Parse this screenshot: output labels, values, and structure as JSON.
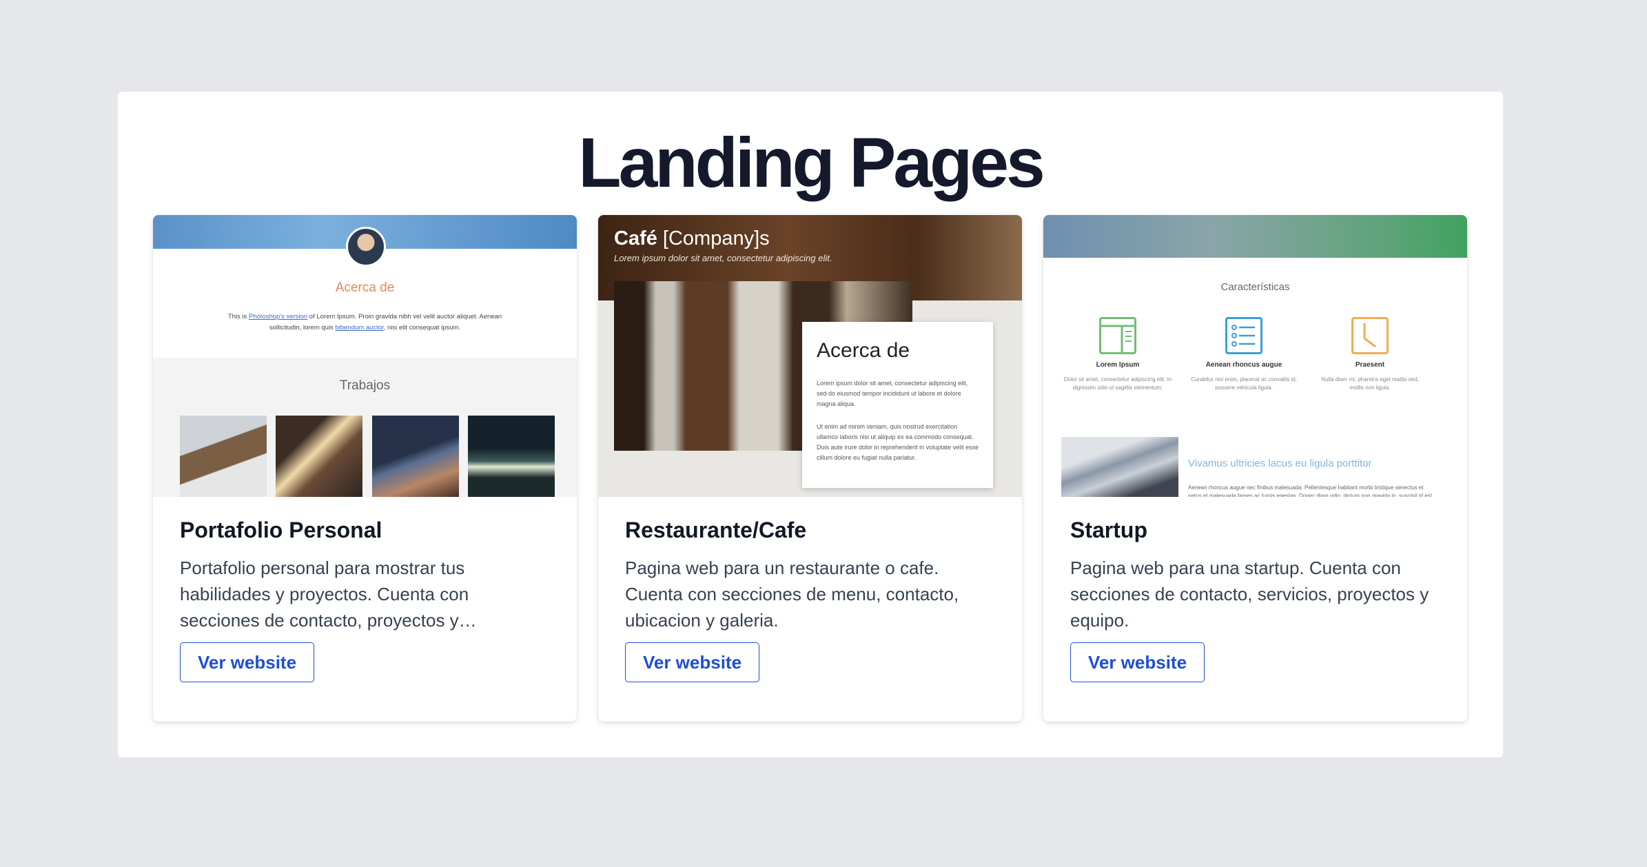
{
  "page": {
    "heading": "Landing Pages"
  },
  "cards": [
    {
      "title": "Portafolio Personal",
      "description": "Portafolio personal para mostrar tus habilidades y proyectos. Cuenta con secciones de contacto, proyectos y…",
      "button": "Ver website",
      "preview": {
        "about_title": "Acerca de",
        "about_text_1": "This is ",
        "about_link_1": "Photoshop's version",
        "about_text_2": " of Lorem Ipsum. Proin gravida nibh vel velit auctor aliquet. Aenean sollicitudin, lorem quis ",
        "about_link_2": "bibendum auctor",
        "about_text_3": ", nisi elit consequat ipsum.",
        "works_title": "Trabajos"
      }
    },
    {
      "title": "Restaurante/Cafe",
      "description": "Pagina web para un restaurante o cafe. Cuenta con secciones de menu, contacto, ubicacion y galeria.",
      "button": "Ver website",
      "preview": {
        "brand_bold": "Café",
        "brand_rest": " [Company]s",
        "tagline": "Lorem ipsum dolor sit amet, consectetur adipiscing elit.",
        "about_title": "Acerca de",
        "about_p1": "Lorem ipsum dolor sit amet, consectetur adipiscing elit, sed do eiusmod tempor incididunt ut labore et dolore magna aliqua.",
        "about_p2": "Ut enim ad minim veniam, quis nostrud exercitation ullamco laboris nisi ut aliquip ex ea commodo consequat. Duis aute irure dolor in reprehenderit in voluptate velit esse cillum dolore eu fugiat nulla pariatur."
      }
    },
    {
      "title": "Startup",
      "description": "Pagina web para una startup. Cuenta con secciones de contacto, servicios, proyectos y equipo.",
      "button": "Ver website",
      "preview": {
        "features_title": "Características",
        "features": [
          {
            "name": "Lorem Ipsum",
            "desc": "Dolor sit amet, consectetur adipiscing elit. In dignissim odio ut sagittis elementum.",
            "icon": "browser-icon",
            "color": "#6fbf73"
          },
          {
            "name": "Aenean rhoncus augue",
            "desc": "Curabitur nisi enim, placerat ac convallis id, posuere vehicula ligula.",
            "icon": "list-icon",
            "color": "#3aa0d8"
          },
          {
            "name": "Praesent",
            "desc": "Nulla diam mi, pharetra eget mattis sed, mollis non ligula.",
            "icon": "clock-icon",
            "color": "#f0ad4e"
          }
        ],
        "link_title": "Vivamus ultricies lacus eu ligula porttitor",
        "link_text": "Aenean rhoncus augue nec finibus malesuada. Pellentesque habitant morbi tristique senectus et netus et malesuada fames ac turpis egestas. Donec diam odio, dictum non gravida in, suscipit id est."
      }
    }
  ],
  "colors": {
    "page_bg": "#e6e7eb",
    "accent": "#1d4ed8",
    "heading": "#141a2b"
  }
}
